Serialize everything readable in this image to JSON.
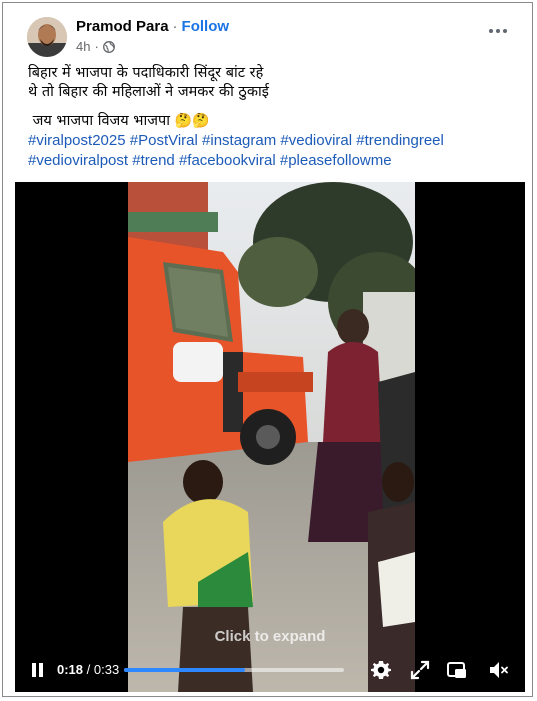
{
  "post": {
    "author": "Pramod Para",
    "separator": "·",
    "follow_label": "Follow",
    "time": "4h",
    "time_separator": "·",
    "text_line1": "बिहार में भाजपा के पदाधिकारी सिंदूर बांट रहे",
    "text_line2": "थे तो बिहार की महिलाओं ने जमकर की ठुकाई",
    "text_line3": "जय भाजपा विजय भाजपा",
    "emoji": "🤔🤔",
    "hashtags": [
      "#viralpost2025",
      "#PostViral",
      "#instagram",
      "#vedioviral",
      "#trendingreel",
      "#vedioviralpost",
      "#trend",
      "#facebookviral",
      "#pleasefollowme"
    ]
  },
  "icons": {
    "privacy": "globe-icon",
    "more": "more-options-icon",
    "pause": "pause-icon",
    "settings": "gear-icon",
    "expand": "expand-icon",
    "pip": "picture-in-picture-icon",
    "mute": "muted-speaker-icon"
  },
  "video": {
    "expand_hint": "Click to expand",
    "current_time": "0:18",
    "time_separator": " / ",
    "duration": "0:33",
    "progress": 0.55
  },
  "colors": {
    "link": "#1b74e4",
    "hashtag": "#1d5bb8",
    "progress": "#2d88ff",
    "truck": "#e8542a"
  }
}
